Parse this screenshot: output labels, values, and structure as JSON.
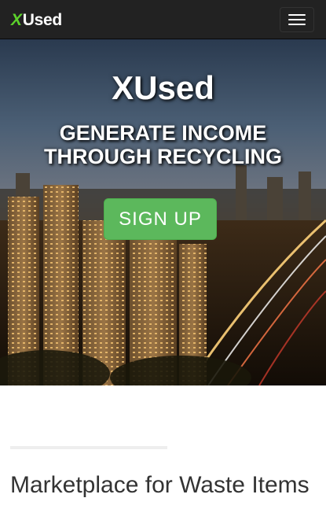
{
  "navbar": {
    "brand_x": "X",
    "brand_rest": "Used",
    "menu_toggle_icon": "hamburger-icon"
  },
  "hero": {
    "title": "XUsed",
    "subtitle": "GENERATE INCOME THROUGH RECYCLING",
    "signup_label": "SIGN UP"
  },
  "section": {
    "title": "Marketplace for Waste Items"
  },
  "colors": {
    "navbar_bg": "#222222",
    "brand_accent": "#5cd12b",
    "signup_button": "#5cb85c",
    "text_dark": "#333333"
  }
}
